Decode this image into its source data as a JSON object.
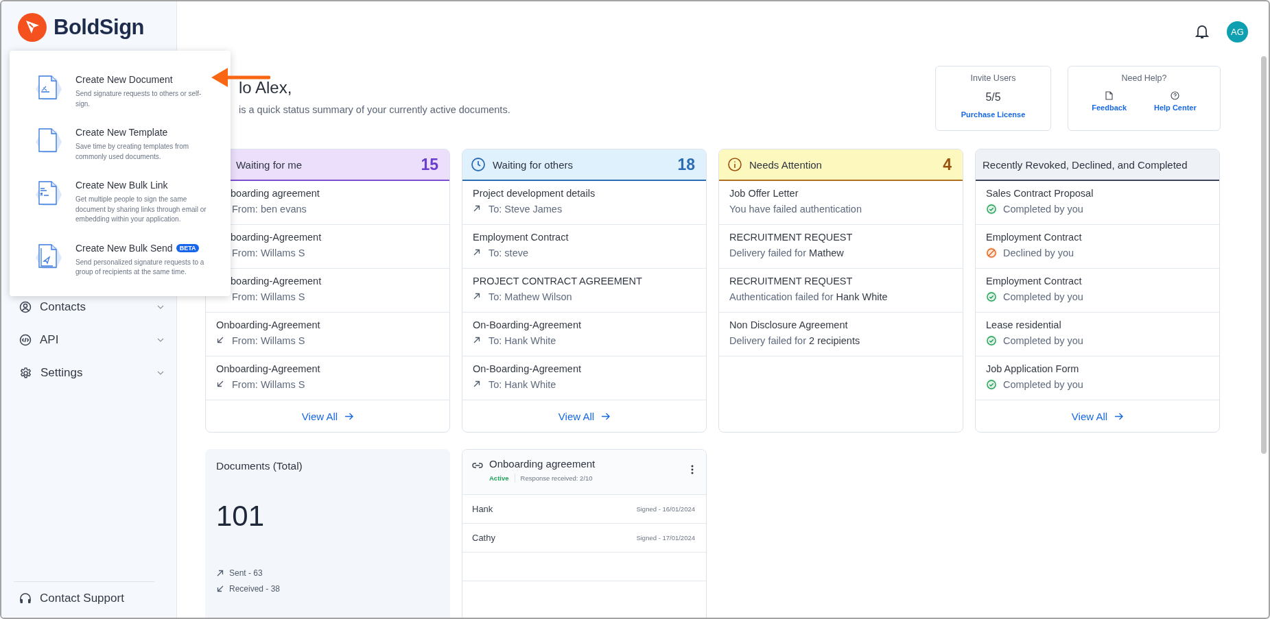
{
  "brand": "BoldSign",
  "sidebar": {
    "items": [
      {
        "label": "Contacts",
        "kind": "contacts"
      },
      {
        "label": "API",
        "kind": "api"
      },
      {
        "label": "Settings",
        "kind": "settings"
      }
    ],
    "support": "Contact Support"
  },
  "header": {
    "avatar": "AG"
  },
  "greeting": {
    "title": "lo Alex,",
    "subtitle": "is a quick status summary of your currently active documents."
  },
  "invite": {
    "title": "Invite Users",
    "count": "5/5",
    "link": "Purchase License"
  },
  "help": {
    "title": "Need Help?",
    "links": [
      {
        "label": "Feedback",
        "kind": "feedback"
      },
      {
        "label": "Help Center",
        "kind": "help"
      }
    ]
  },
  "status_cards": [
    {
      "title": "Waiting for me",
      "count": "15",
      "kind": "purple",
      "view_all": "View All",
      "rows": [
        {
          "title": "boarding agreement",
          "detail": "From: ben evans"
        },
        {
          "title": "boarding-Agreement",
          "detail": "From: Willams S"
        },
        {
          "title": "boarding-Agreement",
          "detail": "From: Willams S"
        },
        {
          "title": "Onboarding-Agreement",
          "detail": "From: Willams S",
          "kind": "incoming"
        },
        {
          "title": "Onboarding-Agreement",
          "detail": "From: Willams S",
          "kind": "incoming"
        }
      ]
    },
    {
      "title": "Waiting for others",
      "count": "18",
      "kind": "blue",
      "view_all": "View All",
      "rows": [
        {
          "title": "Project development details",
          "detail": "To: Steve James",
          "kind": "outgoing"
        },
        {
          "title": "Employment Contract",
          "detail": "To: steve",
          "kind": "outgoing"
        },
        {
          "title": "PROJECT CONTRACT AGREEMENT",
          "detail": "To: Mathew Wilson",
          "kind": "outgoing"
        },
        {
          "title": "On-Boarding-Agreement",
          "detail": "To: Hank White",
          "kind": "outgoing"
        },
        {
          "title": "On-Boarding-Agreement",
          "detail": "To: Hank White",
          "kind": "outgoing"
        }
      ]
    },
    {
      "title": "Needs Attention",
      "count": "4",
      "kind": "yellow",
      "rows": [
        {
          "title": "Job Offer Letter",
          "detail": "You have failed authentication"
        },
        {
          "title": "RECRUITMENT REQUEST",
          "detail": "Delivery failed for **Mathew**"
        },
        {
          "title": "RECRUITMENT REQUEST",
          "detail": "Authentication failed for **Hank White**"
        },
        {
          "title": "Non Disclosure Agreement",
          "detail": "Delivery failed for **2 recipients**"
        }
      ]
    },
    {
      "title": "Recently Revoked, Declined, and Completed",
      "kind": "grey",
      "view_all": "View All",
      "rows": [
        {
          "title": "Sales Contract Proposal",
          "detail": "Completed by you",
          "kind": "completed"
        },
        {
          "title": "Employment Contract",
          "detail": "Declined by you",
          "kind": "declined"
        },
        {
          "title": "Employment Contract",
          "detail": "Completed by you",
          "kind": "completed"
        },
        {
          "title": "Lease residential",
          "detail": "Completed by you",
          "kind": "completed"
        },
        {
          "title": "Job Application Form",
          "detail": "Completed by you",
          "kind": "completed"
        }
      ]
    }
  ],
  "documents_total": {
    "title": "Documents (Total)",
    "total": "101",
    "sent": "Sent - 63",
    "received": "Received - 38"
  },
  "bulk_link": {
    "title": "Onboarding agreement",
    "status": "Active",
    "response": "Response received: 2/10",
    "signers": [
      {
        "name": "Hank",
        "signed": "Signed - 16/01/2024"
      },
      {
        "name": "Cathy",
        "signed": "Signed - 17/01/2024"
      }
    ]
  },
  "menu": {
    "items": [
      {
        "title": "Create New Document",
        "description": "Send signature requests to others or self-sign.",
        "kind": "document"
      },
      {
        "title": "Create New Template",
        "description": "Save time by creating templates from commonly used documents.",
        "kind": "template"
      },
      {
        "title": "Create New Bulk Link",
        "description": "Get multiple people to sign the same document by sharing links through email or embedding within your application.",
        "kind": "bulk_link"
      },
      {
        "title": "Create New Bulk Send",
        "description": "Send personalized signature requests to a group of recipients at the same time.",
        "kind": "bulk_send",
        "badge": "BETA"
      }
    ]
  }
}
